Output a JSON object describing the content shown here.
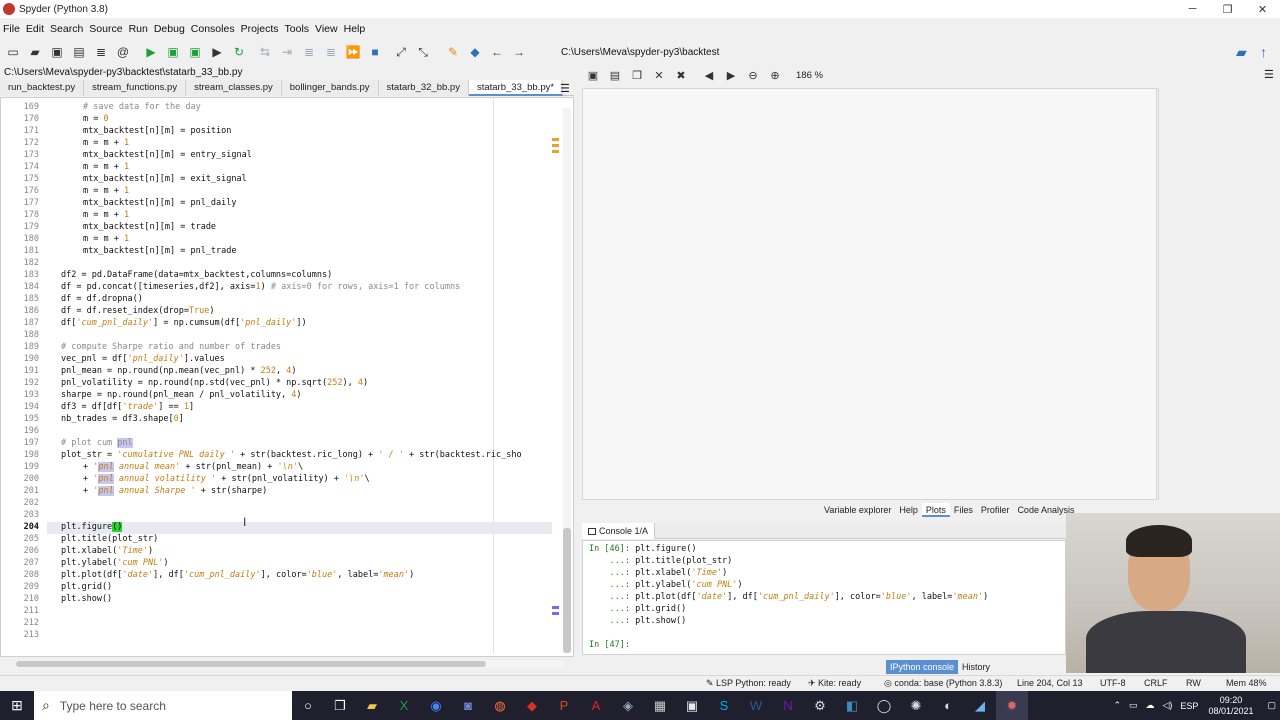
{
  "window": {
    "title": "Spyder (Python 3.8)",
    "min": "─",
    "max": "❐",
    "close": "✕"
  },
  "menu": [
    "File",
    "Edit",
    "Search",
    "Source",
    "Run",
    "Debug",
    "Consoles",
    "Projects",
    "Tools",
    "View",
    "Help"
  ],
  "toolbar": {
    "working_dir": "C:\\Users\\Meva\\spyder-py3\\backtest"
  },
  "editor": {
    "path": "C:\\Users\\Meva\\spyder-py3\\backtest\\statarb_33_bb.py",
    "tabs": [
      "run_backtest.py",
      "stream_functions.py",
      "stream_classes.py",
      "bollinger_bands.py",
      "statarb_32_bb.py",
      "statarb_33_bb.py*"
    ],
    "active_tab": 5,
    "tab_menu": "☰",
    "lines": [
      {
        "n": "169",
        "i": 4,
        "parts": [
          {
            "t": "# save data for the day",
            "c": "cm"
          }
        ]
      },
      {
        "n": "170",
        "i": 4,
        "parts": [
          {
            "t": "m = "
          },
          {
            "t": "0",
            "c": "num"
          }
        ]
      },
      {
        "n": "171",
        "i": 4,
        "parts": [
          {
            "t": "mtx_backtest[n][m] = position"
          }
        ]
      },
      {
        "n": "172",
        "i": 4,
        "parts": [
          {
            "t": "m = m + "
          },
          {
            "t": "1",
            "c": "num"
          }
        ]
      },
      {
        "n": "173",
        "i": 4,
        "parts": [
          {
            "t": "mtx_backtest[n][m] = entry_signal"
          }
        ]
      },
      {
        "n": "174",
        "i": 4,
        "parts": [
          {
            "t": "m = m + "
          },
          {
            "t": "1",
            "c": "num"
          }
        ]
      },
      {
        "n": "175",
        "i": 4,
        "parts": [
          {
            "t": "mtx_backtest[n][m] = exit_signal"
          }
        ]
      },
      {
        "n": "176",
        "i": 4,
        "parts": [
          {
            "t": "m = m + "
          },
          {
            "t": "1",
            "c": "num"
          }
        ]
      },
      {
        "n": "177",
        "i": 4,
        "parts": [
          {
            "t": "mtx_backtest[n][m] = pnl_daily"
          }
        ]
      },
      {
        "n": "178",
        "i": 4,
        "parts": [
          {
            "t": "m = m + "
          },
          {
            "t": "1",
            "c": "num"
          }
        ]
      },
      {
        "n": "179",
        "i": 4,
        "parts": [
          {
            "t": "mtx_backtest[n][m] = trade"
          }
        ]
      },
      {
        "n": "180",
        "i": 4,
        "parts": [
          {
            "t": "m = m + "
          },
          {
            "t": "1",
            "c": "num"
          }
        ]
      },
      {
        "n": "181",
        "i": 4,
        "parts": [
          {
            "t": "mtx_backtest[n][m] = pnl_trade"
          }
        ]
      },
      {
        "n": "182",
        "i": 0,
        "parts": []
      },
      {
        "n": "183",
        "i": 0,
        "parts": [
          {
            "t": "df2 = pd.DataFrame(data=mtx_backtest,columns=columns)"
          }
        ]
      },
      {
        "n": "184",
        "i": 0,
        "parts": [
          {
            "t": "df = pd.concat([timeseries,df2], axis="
          },
          {
            "t": "1",
            "c": "num"
          },
          {
            "t": ") "
          },
          {
            "t": "# axis=0 for rows, axis=1 for columns",
            "c": "cm"
          }
        ]
      },
      {
        "n": "185",
        "i": 0,
        "parts": [
          {
            "t": "df = df.dropna()"
          }
        ]
      },
      {
        "n": "186",
        "i": 0,
        "parts": [
          {
            "t": "df = df.reset_index(drop="
          },
          {
            "t": "True",
            "c": "num"
          },
          {
            "t": ")"
          }
        ]
      },
      {
        "n": "187",
        "i": 0,
        "parts": [
          {
            "t": "df["
          },
          {
            "t": "'cum_pnl_daily'",
            "c": "str"
          },
          {
            "t": "] = np.cumsum(df["
          },
          {
            "t": "'pnl_daily'",
            "c": "str"
          },
          {
            "t": "])"
          }
        ]
      },
      {
        "n": "188",
        "i": 0,
        "parts": []
      },
      {
        "n": "189",
        "i": 0,
        "parts": [
          {
            "t": "# compute Sharpe ratio and number of trades",
            "c": "cm"
          }
        ]
      },
      {
        "n": "190",
        "i": 0,
        "parts": [
          {
            "t": "vec_pnl = df["
          },
          {
            "t": "'pnl_daily'",
            "c": "str"
          },
          {
            "t": "].values"
          }
        ]
      },
      {
        "n": "191",
        "i": 0,
        "parts": [
          {
            "t": "pnl_mean = np.round(np.mean(vec_pnl) * "
          },
          {
            "t": "252",
            "c": "num"
          },
          {
            "t": ", "
          },
          {
            "t": "4",
            "c": "num"
          },
          {
            "t": ")"
          }
        ]
      },
      {
        "n": "192",
        "i": 0,
        "parts": [
          {
            "t": "pnl_volatility = np.round(np.std(vec_pnl) * np.sqrt("
          },
          {
            "t": "252",
            "c": "num"
          },
          {
            "t": "), "
          },
          {
            "t": "4",
            "c": "num"
          },
          {
            "t": ")"
          }
        ]
      },
      {
        "n": "193",
        "i": 0,
        "parts": [
          {
            "t": "sharpe = np.round(pnl_mean / pnl_volatility, "
          },
          {
            "t": "4",
            "c": "num"
          },
          {
            "t": ")"
          }
        ]
      },
      {
        "n": "194",
        "i": 0,
        "parts": [
          {
            "t": "df3 = df[df["
          },
          {
            "t": "'trade'",
            "c": "str"
          },
          {
            "t": "] == "
          },
          {
            "t": "1",
            "c": "num"
          },
          {
            "t": "]"
          }
        ]
      },
      {
        "n": "195",
        "i": 0,
        "parts": [
          {
            "t": "nb_trades = df3.shape["
          },
          {
            "t": "0",
            "c": "num"
          },
          {
            "t": "]"
          }
        ]
      },
      {
        "n": "196",
        "i": 0,
        "parts": []
      },
      {
        "n": "197",
        "i": 0,
        "parts": [
          {
            "t": "# plot cum ",
            "c": "cm"
          },
          {
            "t": "pnl",
            "c": "cm hl"
          }
        ]
      },
      {
        "n": "198",
        "i": 0,
        "parts": [
          {
            "t": "plot_str = "
          },
          {
            "t": "'cumulative PNL daily '",
            "c": "str"
          },
          {
            "t": " + str(backtest.ric_long) + "
          },
          {
            "t": "' / '",
            "c": "str"
          },
          {
            "t": " + str(backtest.ric_sho"
          }
        ]
      },
      {
        "n": "199",
        "i": 4,
        "parts": [
          {
            "t": "+ "
          },
          {
            "t": "'",
            "c": "str"
          },
          {
            "t": "pnl",
            "c": "str hl"
          },
          {
            "t": " annual mean'",
            "c": "str"
          },
          {
            "t": " + str(pnl_mean) + "
          },
          {
            "t": "'\\n'",
            "c": "str"
          },
          {
            "t": "\\"
          }
        ]
      },
      {
        "n": "200",
        "i": 4,
        "parts": [
          {
            "t": "+ "
          },
          {
            "t": "'",
            "c": "str"
          },
          {
            "t": "pnl",
            "c": "str hl"
          },
          {
            "t": " annual volatility '",
            "c": "str"
          },
          {
            "t": " + str(pnl_volatility) + "
          },
          {
            "t": "'\\n'",
            "c": "str"
          },
          {
            "t": "\\"
          }
        ]
      },
      {
        "n": "201",
        "i": 4,
        "parts": [
          {
            "t": "+ "
          },
          {
            "t": "'",
            "c": "str"
          },
          {
            "t": "pnl",
            "c": "str hl"
          },
          {
            "t": " annual Sharpe '",
            "c": "str"
          },
          {
            "t": " + str(sharpe)"
          }
        ]
      },
      {
        "n": "202",
        "i": 0,
        "parts": []
      },
      {
        "n": "203",
        "i": 0,
        "parts": []
      },
      {
        "n": "204",
        "i": 0,
        "parts": [
          {
            "t": "plt.figure"
          },
          {
            "t": "()",
            "c": "brk"
          }
        ]
      },
      {
        "n": "205",
        "i": 0,
        "parts": [
          {
            "t": "plt.title(plot_str)"
          }
        ]
      },
      {
        "n": "206",
        "i": 0,
        "parts": [
          {
            "t": "plt.xlabel("
          },
          {
            "t": "'Time'",
            "c": "str"
          },
          {
            "t": ")"
          }
        ]
      },
      {
        "n": "207",
        "i": 0,
        "parts": [
          {
            "t": "plt.ylabel("
          },
          {
            "t": "'cum PNL'",
            "c": "str"
          },
          {
            "t": ")"
          }
        ]
      },
      {
        "n": "208",
        "i": 0,
        "parts": [
          {
            "t": "plt.plot(df["
          },
          {
            "t": "'date'",
            "c": "str"
          },
          {
            "t": "], df["
          },
          {
            "t": "'cum_pnl_daily'",
            "c": "str"
          },
          {
            "t": "], color="
          },
          {
            "t": "'blue'",
            "c": "str"
          },
          {
            "t": ", label="
          },
          {
            "t": "'mean'",
            "c": "str"
          },
          {
            "t": ")"
          }
        ]
      },
      {
        "n": "209",
        "i": 0,
        "parts": [
          {
            "t": "plt.grid()"
          }
        ]
      },
      {
        "n": "210",
        "i": 0,
        "parts": [
          {
            "t": "plt.show()"
          }
        ]
      },
      {
        "n": "211",
        "i": 0,
        "parts": []
      },
      {
        "n": "212",
        "i": 0,
        "parts": []
      },
      {
        "n": "213",
        "i": 0,
        "parts": []
      }
    ]
  },
  "plots": {
    "zoom": "186 %"
  },
  "pane_tabs": [
    "Variable explorer",
    "Help",
    "Plots",
    "Files",
    "Profiler",
    "Code Analysis"
  ],
  "pane_active": 2,
  "console": {
    "tab": "Console 1/A",
    "lines": [
      {
        "p": "In [46]: ",
        "parts": [
          {
            "t": "plt.figure()"
          }
        ]
      },
      {
        "p": "    ...: ",
        "parts": [
          {
            "t": "plt.title(plot_str)"
          }
        ]
      },
      {
        "p": "    ...: ",
        "parts": [
          {
            "t": "plt.xlabel("
          },
          {
            "t": "'Time'",
            "c": "str"
          },
          {
            "t": ")"
          }
        ]
      },
      {
        "p": "    ...: ",
        "parts": [
          {
            "t": "plt.ylabel("
          },
          {
            "t": "'cum PNL'",
            "c": "str"
          },
          {
            "t": ")"
          }
        ]
      },
      {
        "p": "    ...: ",
        "parts": [
          {
            "t": "plt.plot(df["
          },
          {
            "t": "'date'",
            "c": "str"
          },
          {
            "t": "], df["
          },
          {
            "t": "'cum_pnl_daily'",
            "c": "str"
          },
          {
            "t": "], color="
          },
          {
            "t": "'blue'",
            "c": "str"
          },
          {
            "t": ", label="
          },
          {
            "t": "'mean'",
            "c": "str"
          },
          {
            "t": ")"
          }
        ]
      },
      {
        "p": "    ...: ",
        "parts": [
          {
            "t": "plt.grid()"
          }
        ]
      },
      {
        "p": "    ...: ",
        "parts": [
          {
            "t": "plt.show()"
          }
        ]
      },
      {
        "p": "",
        "parts": []
      },
      {
        "p": "In [47]: ",
        "parts": []
      }
    ]
  },
  "bottom_tabs": [
    "IPython console",
    "History"
  ],
  "status": {
    "lsp": "LSP Python: ready",
    "kite": "Kite: ready",
    "conda": "conda: base (Python 3.8.3)",
    "pos": "Line 204, Col 13",
    "enc": "UTF-8",
    "eol": "CRLF",
    "rw": "RW",
    "mem": "Mem 48%"
  },
  "taskbar": {
    "search_placeholder": "Type here to search",
    "lang": "ESP",
    "time": "09:20",
    "date": "08/01/2021"
  }
}
